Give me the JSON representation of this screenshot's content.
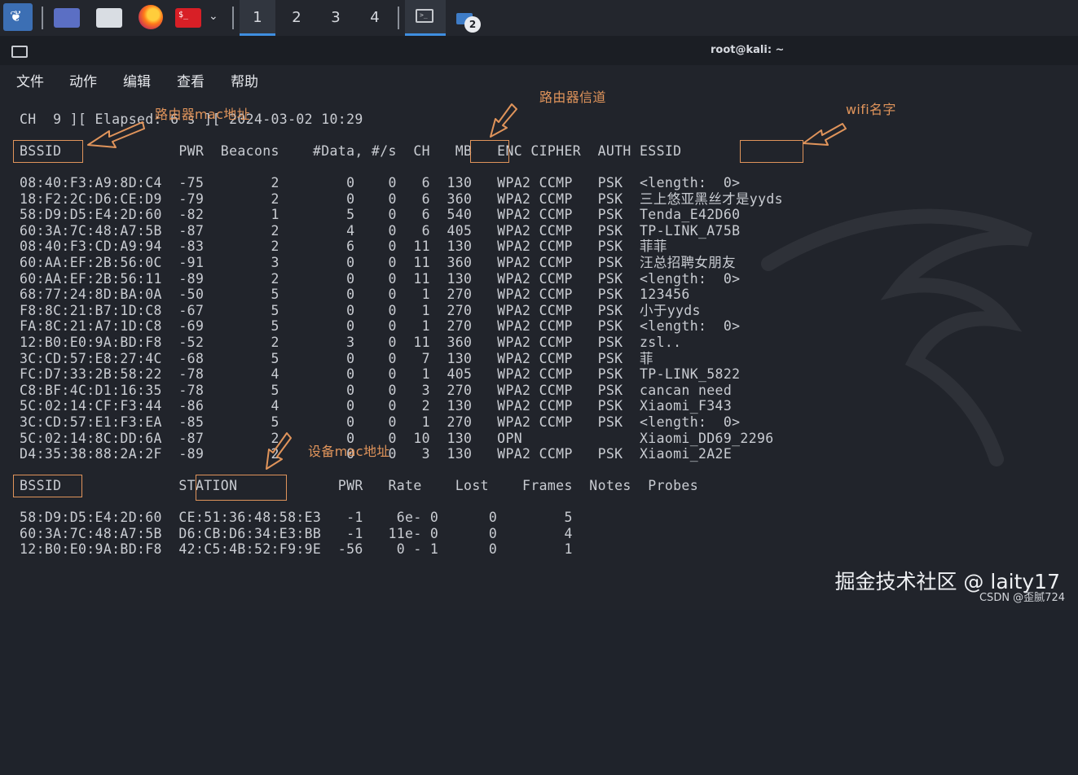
{
  "taskbar": {
    "workspaces": [
      "1",
      "2",
      "3",
      "4"
    ],
    "active_workspace": "1",
    "terminal_prompt_glyph": ">_",
    "group_badge": "2",
    "icons": [
      "kali-dragon-icon",
      "desktop-icon",
      "file-manager-icon",
      "firefox-icon",
      "terminal-launcher-icon",
      "chevron-down-icon"
    ]
  },
  "window": {
    "title": "root@kali: ~",
    "menu": [
      "文件",
      "动作",
      "编辑",
      "查看",
      "帮助"
    ]
  },
  "terminal": {
    "status_line": "CH  9 ][ Elapsed: 6 s ][ 2024-03-02 10:29",
    "ap_header": "BSSID              PWR  Beacons    #Data, #/s  CH   MB   ENC CIPHER  AUTH ESSID",
    "ap_rows": [
      "08:40:F3:A9:8D:C4  -75        2        0    0   6  130   WPA2 CCMP   PSK  <length:  0>",
      "18:F2:2C:D6:CE:D9  -79        2        0    0   6  360   WPA2 CCMP   PSK  三上悠亚黑丝才是yyds",
      "58:D9:D5:E4:2D:60  -82        1        5    0   6  540   WPA2 CCMP   PSK  Tenda_E42D60",
      "60:3A:7C:48:A7:5B  -87        2        4    0   6  405   WPA2 CCMP   PSK  TP-LINK_A75B",
      "08:40:F3:CD:A9:94  -83        2        6    0  11  130   WPA2 CCMP   PSK  菲菲",
      "60:AA:EF:2B:56:0C  -91        3        0    0  11  360   WPA2 CCMP   PSK  汪总招聘女朋友",
      "60:AA:EF:2B:56:11  -89        2        0    0  11  130   WPA2 CCMP   PSK  <length:  0>",
      "68:77:24:8D:BA:0A  -50        5        0    0   1  270   WPA2 CCMP   PSK  123456",
      "F8:8C:21:B7:1D:C8  -67        5        0    0   1  270   WPA2 CCMP   PSK  小于yyds",
      "FA:8C:21:A7:1D:C8  -69        5        0    0   1  270   WPA2 CCMP   PSK  <length:  0>",
      "12:B0:E0:9A:BD:F8  -52        2        3    0  11  360   WPA2 CCMP   PSK  zsl..",
      "3C:CD:57:E8:27:4C  -68        5        0    0   7  130   WPA2 CCMP   PSK  菲",
      "FC:D7:33:2B:58:22  -78        4        0    0   1  405   WPA2 CCMP   PSK  TP-LINK_5822",
      "C8:BF:4C:D1:16:35  -78        5        0    0   3  270   WPA2 CCMP   PSK  cancan need",
      "5C:02:14:CF:F3:44  -86        4        0    0   2  130   WPA2 CCMP   PSK  Xiaomi_F343",
      "3C:CD:57:E1:F3:EA  -85        5        0    0   1  270   WPA2 CCMP   PSK  <length:  0>",
      "5C:02:14:8C:DD:6A  -87        2        0    0  10  130   OPN              Xiaomi_DD69_2296",
      "D4:35:38:88:2A:2F  -89        2        0    0   3  130   WPA2 CCMP   PSK  Xiaomi_2A2E"
    ],
    "station_header": "BSSID              STATION            PWR   Rate    Lost    Frames  Notes  Probes",
    "station_rows": [
      "58:D9:D5:E4:2D:60  CE:51:36:48:58:E3   -1    6e- 0      0        5",
      "60:3A:7C:48:A7:5B  D6:CB:D6:34:E3:BB   -1   11e- 0      0        4",
      "12:B0:E0:9A:BD:F8  42:C5:4B:52:F9:9E  -56    0 - 1      0        1"
    ]
  },
  "annotations": {
    "router_channel": "路由器信道",
    "router_mac": "路由器mac地址",
    "wifi_name": "wifi名字",
    "device_mac": "设备mac地址",
    "color": "#e0945b"
  },
  "watermark": {
    "main": "掘金技术社区 @ laity17",
    "small": "CSDN @歪腻724"
  }
}
